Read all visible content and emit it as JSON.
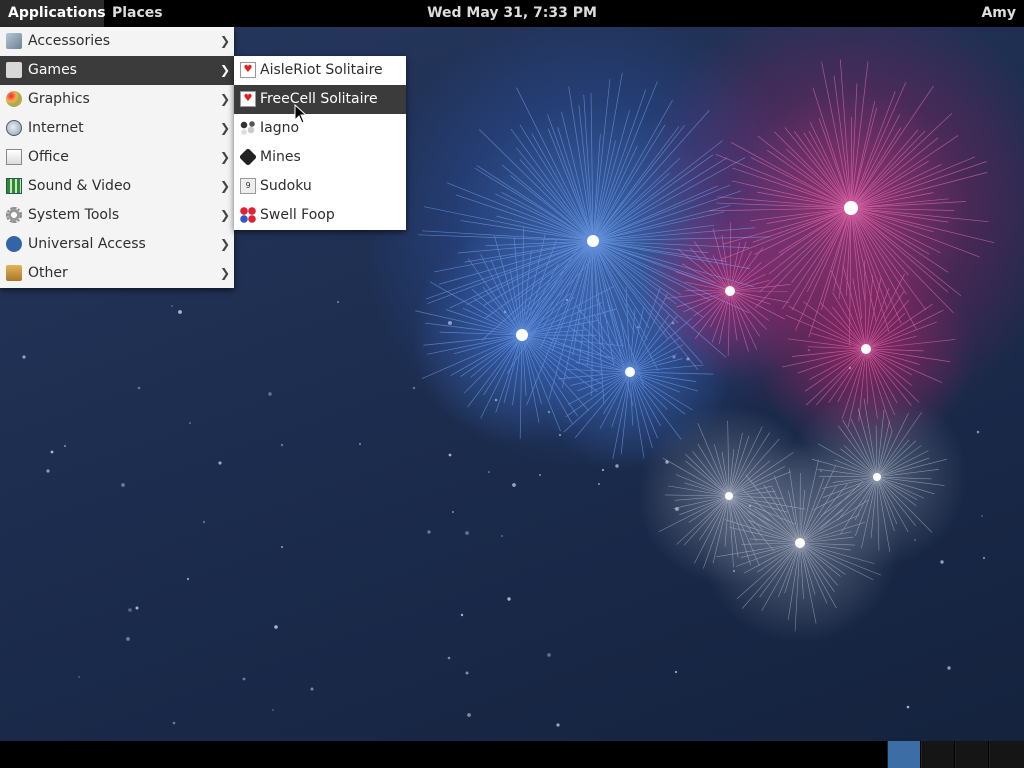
{
  "top_panel": {
    "applications_label": "Applications",
    "places_label": "Places",
    "clock": "Wed May 31,  7:33 PM",
    "user": "Amy"
  },
  "applications_menu": {
    "items": [
      {
        "label": "Accessories",
        "icon": "accessories-icon"
      },
      {
        "label": "Games",
        "icon": "games-icon",
        "selected": true
      },
      {
        "label": "Graphics",
        "icon": "graphics-icon"
      },
      {
        "label": "Internet",
        "icon": "internet-icon"
      },
      {
        "label": "Office",
        "icon": "office-icon"
      },
      {
        "label": "Sound & Video",
        "icon": "sound-video-icon"
      },
      {
        "label": "System Tools",
        "icon": "system-tools-icon"
      },
      {
        "label": "Universal Access",
        "icon": "universal-access-icon"
      },
      {
        "label": "Other",
        "icon": "other-icon"
      }
    ]
  },
  "games_submenu": {
    "items": [
      {
        "label": "AisleRiot Solitaire",
        "icon": "aisleriot-icon"
      },
      {
        "label": "FreeCell Solitaire",
        "icon": "freecell-icon",
        "hovered": true
      },
      {
        "label": "Iagno",
        "icon": "iagno-icon"
      },
      {
        "label": "Mines",
        "icon": "mines-icon"
      },
      {
        "label": "Sudoku",
        "icon": "sudoku-icon"
      },
      {
        "label": "Swell Foop",
        "icon": "swell-foop-icon"
      }
    ]
  },
  "workspaces": {
    "count": 4,
    "active_index": 0
  },
  "colors": {
    "panel": "#000000",
    "menu_selection": "#3b3b3b",
    "workspace_active": "#3c6ea5"
  }
}
